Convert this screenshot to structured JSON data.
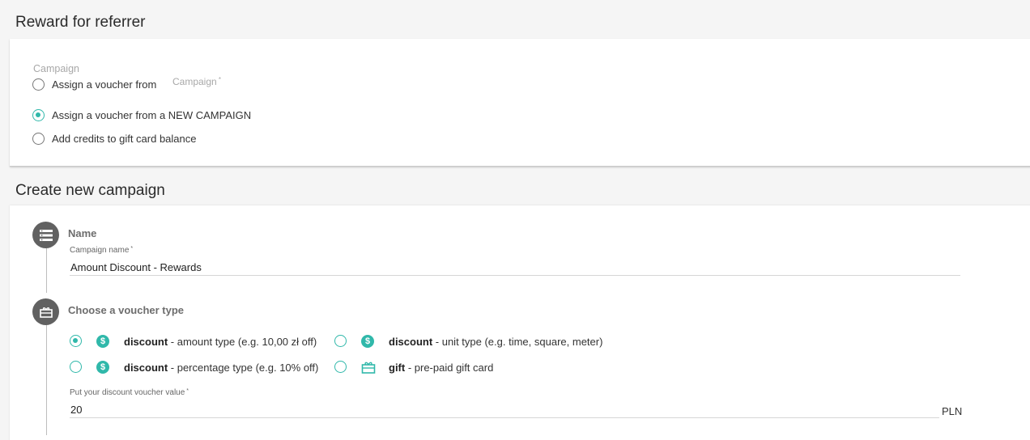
{
  "referrer": {
    "title": "Reward for referrer",
    "campaign_label": "Campaign",
    "campaign_select_placeholder": "Campaign",
    "options": [
      {
        "label": "Assign a voucher from",
        "checked": false
      },
      {
        "label": "Assign a voucher from a NEW CAMPAIGN",
        "checked": true
      },
      {
        "label": "Add credits to gift card balance",
        "checked": false
      }
    ]
  },
  "create": {
    "title": "Create new campaign",
    "name_step": {
      "title": "Name",
      "field_label": "Campaign name",
      "value": "Amount Discount - Rewards",
      "icon": "list-icon"
    },
    "type_step": {
      "title": "Choose a voucher type",
      "icon": "gift-icon",
      "types": [
        {
          "bold": "discount",
          "rest": " - amount type (e.g. 10,00 zł off)",
          "checked": true,
          "icon": "dollar-icon"
        },
        {
          "bold": "discount",
          "rest": " - unit type (e.g. time, square, meter)",
          "checked": false,
          "icon": "dollar-icon"
        },
        {
          "bold": "discount",
          "rest": " - percentage type (e.g. 10% off)",
          "checked": false,
          "icon": "dollar-icon"
        },
        {
          "bold": "gift",
          "rest": " - pre-paid gift card",
          "checked": false,
          "icon": "gift-card-icon"
        }
      ],
      "value_label": "Put your discount voucher value",
      "value": "20",
      "currency": "PLN",
      "dollar_symbol": "$"
    }
  },
  "colors": {
    "accent": "#30b8aa",
    "step_circle": "#616161"
  }
}
